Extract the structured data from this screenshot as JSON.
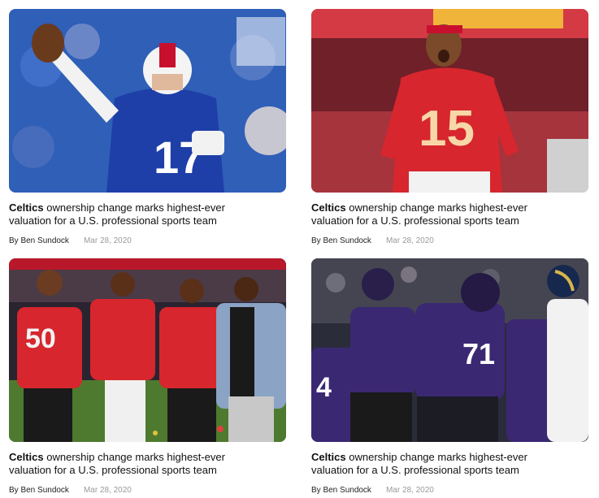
{
  "articles": [
    {
      "team": "Celtics",
      "headline_rest": " ownership change marks highest-ever valuation for a U.S. professional sports team",
      "author": "By Ben Sundock",
      "date": "Mar 28, 2020",
      "image": {
        "jersey_number": "17",
        "accent": "#1e3fa8"
      }
    },
    {
      "team": "Celtics",
      "headline_rest": " ownership change marks highest-ever valuation for a U.S. professional sports team",
      "author": "By Ben Sundock",
      "date": "Mar 28, 2020",
      "image": {
        "jersey_number": "15",
        "accent": "#d7262e"
      }
    },
    {
      "team": "Celtics",
      "headline_rest": " ownership change marks highest-ever valuation for a U.S. professional sports team",
      "author": "By Ben Sundock",
      "date": "Mar 28, 2020",
      "image": {
        "jersey_number": "50",
        "accent": "#d7262e"
      }
    },
    {
      "team": "Celtics",
      "headline_rest": " ownership change marks highest-ever valuation for a U.S. professional sports team",
      "author": "By Ben Sundock",
      "date": "Mar 28, 2020",
      "image": {
        "jersey_number": "71",
        "accent": "#3b2873"
      }
    }
  ]
}
